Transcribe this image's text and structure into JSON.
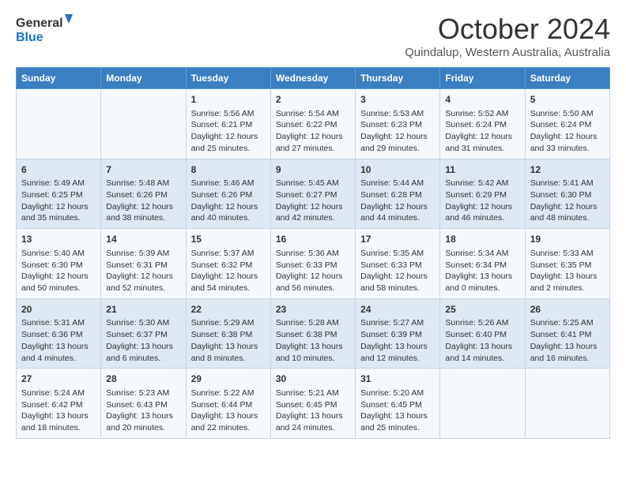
{
  "logo": {
    "line1": "General",
    "line2": "Blue"
  },
  "title": "October 2024",
  "subtitle": "Quindalup, Western Australia, Australia",
  "header_days": [
    "Sunday",
    "Monday",
    "Tuesday",
    "Wednesday",
    "Thursday",
    "Friday",
    "Saturday"
  ],
  "weeks": [
    [
      {
        "day": "",
        "info": ""
      },
      {
        "day": "",
        "info": ""
      },
      {
        "day": "1",
        "info": "Sunrise: 5:56 AM\nSunset: 6:21 PM\nDaylight: 12 hours\nand 25 minutes."
      },
      {
        "day": "2",
        "info": "Sunrise: 5:54 AM\nSunset: 6:22 PM\nDaylight: 12 hours\nand 27 minutes."
      },
      {
        "day": "3",
        "info": "Sunrise: 5:53 AM\nSunset: 6:23 PM\nDaylight: 12 hours\nand 29 minutes."
      },
      {
        "day": "4",
        "info": "Sunrise: 5:52 AM\nSunset: 6:24 PM\nDaylight: 12 hours\nand 31 minutes."
      },
      {
        "day": "5",
        "info": "Sunrise: 5:50 AM\nSunset: 6:24 PM\nDaylight: 12 hours\nand 33 minutes."
      }
    ],
    [
      {
        "day": "6",
        "info": "Sunrise: 5:49 AM\nSunset: 6:25 PM\nDaylight: 12 hours\nand 35 minutes."
      },
      {
        "day": "7",
        "info": "Sunrise: 5:48 AM\nSunset: 6:26 PM\nDaylight: 12 hours\nand 38 minutes."
      },
      {
        "day": "8",
        "info": "Sunrise: 5:46 AM\nSunset: 6:26 PM\nDaylight: 12 hours\nand 40 minutes."
      },
      {
        "day": "9",
        "info": "Sunrise: 5:45 AM\nSunset: 6:27 PM\nDaylight: 12 hours\nand 42 minutes."
      },
      {
        "day": "10",
        "info": "Sunrise: 5:44 AM\nSunset: 6:28 PM\nDaylight: 12 hours\nand 44 minutes."
      },
      {
        "day": "11",
        "info": "Sunrise: 5:42 AM\nSunset: 6:29 PM\nDaylight: 12 hours\nand 46 minutes."
      },
      {
        "day": "12",
        "info": "Sunrise: 5:41 AM\nSunset: 6:30 PM\nDaylight: 12 hours\nand 48 minutes."
      }
    ],
    [
      {
        "day": "13",
        "info": "Sunrise: 5:40 AM\nSunset: 6:30 PM\nDaylight: 12 hours\nand 50 minutes."
      },
      {
        "day": "14",
        "info": "Sunrise: 5:39 AM\nSunset: 6:31 PM\nDaylight: 12 hours\nand 52 minutes."
      },
      {
        "day": "15",
        "info": "Sunrise: 5:37 AM\nSunset: 6:32 PM\nDaylight: 12 hours\nand 54 minutes."
      },
      {
        "day": "16",
        "info": "Sunrise: 5:36 AM\nSunset: 6:33 PM\nDaylight: 12 hours\nand 56 minutes."
      },
      {
        "day": "17",
        "info": "Sunrise: 5:35 AM\nSunset: 6:33 PM\nDaylight: 12 hours\nand 58 minutes."
      },
      {
        "day": "18",
        "info": "Sunrise: 5:34 AM\nSunset: 6:34 PM\nDaylight: 13 hours\nand 0 minutes."
      },
      {
        "day": "19",
        "info": "Sunrise: 5:33 AM\nSunset: 6:35 PM\nDaylight: 13 hours\nand 2 minutes."
      }
    ],
    [
      {
        "day": "20",
        "info": "Sunrise: 5:31 AM\nSunset: 6:36 PM\nDaylight: 13 hours\nand 4 minutes."
      },
      {
        "day": "21",
        "info": "Sunrise: 5:30 AM\nSunset: 6:37 PM\nDaylight: 13 hours\nand 6 minutes."
      },
      {
        "day": "22",
        "info": "Sunrise: 5:29 AM\nSunset: 6:38 PM\nDaylight: 13 hours\nand 8 minutes."
      },
      {
        "day": "23",
        "info": "Sunrise: 5:28 AM\nSunset: 6:38 PM\nDaylight: 13 hours\nand 10 minutes."
      },
      {
        "day": "24",
        "info": "Sunrise: 5:27 AM\nSunset: 6:39 PM\nDaylight: 13 hours\nand 12 minutes."
      },
      {
        "day": "25",
        "info": "Sunrise: 5:26 AM\nSunset: 6:40 PM\nDaylight: 13 hours\nand 14 minutes."
      },
      {
        "day": "26",
        "info": "Sunrise: 5:25 AM\nSunset: 6:41 PM\nDaylight: 13 hours\nand 16 minutes."
      }
    ],
    [
      {
        "day": "27",
        "info": "Sunrise: 5:24 AM\nSunset: 6:42 PM\nDaylight: 13 hours\nand 18 minutes."
      },
      {
        "day": "28",
        "info": "Sunrise: 5:23 AM\nSunset: 6:43 PM\nDaylight: 13 hours\nand 20 minutes."
      },
      {
        "day": "29",
        "info": "Sunrise: 5:22 AM\nSunset: 6:44 PM\nDaylight: 13 hours\nand 22 minutes."
      },
      {
        "day": "30",
        "info": "Sunrise: 5:21 AM\nSunset: 6:45 PM\nDaylight: 13 hours\nand 24 minutes."
      },
      {
        "day": "31",
        "info": "Sunrise: 5:20 AM\nSunset: 6:45 PM\nDaylight: 13 hours\nand 25 minutes."
      },
      {
        "day": "",
        "info": ""
      },
      {
        "day": "",
        "info": ""
      }
    ]
  ]
}
